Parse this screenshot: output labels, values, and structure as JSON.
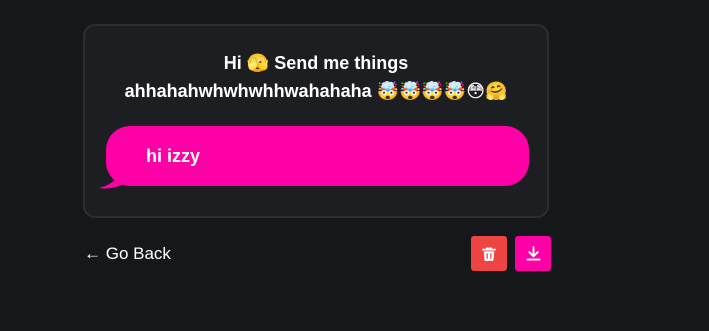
{
  "card": {
    "title_line1": "Hi 🫣 Send me things",
    "title_line2": "ahhahahwhwhwhhwahahaha 🤯🤯🤯🤯😳🤗"
  },
  "message": {
    "text": "hi izzy",
    "bubble_color": "#ff00a7"
  },
  "footer": {
    "back_label": "← Go Back",
    "delete_icon": "trash-icon",
    "delete_color": "#ef4444",
    "download_icon": "download-icon",
    "download_color": "#ff00a7"
  }
}
